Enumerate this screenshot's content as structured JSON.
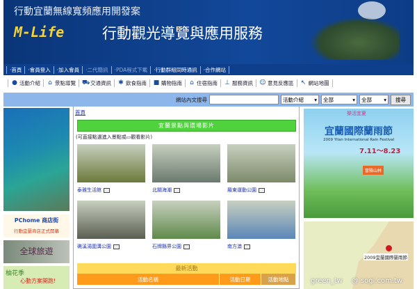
{
  "header": {
    "subtitle": "行動宜蘭無線寬頻應用開發案",
    "logo": "M-Life",
    "title": "行動觀光導覽與應用服務"
  },
  "nav": [
    {
      "label": "‧首頁"
    },
    {
      "label": "‧會員登入"
    },
    {
      "label": "‧加入會員"
    },
    {
      "label": "‧二代簡訊",
      "disabled": true
    },
    {
      "label": "‧PDA程式下載",
      "disabled": true
    },
    {
      "label": "‧行動群組同時通訊"
    },
    {
      "label": "‧合作網站"
    }
  ],
  "iconbar": [
    {
      "label": "活動介紹",
      "icon": "event-icon"
    },
    {
      "label": "景點導覽",
      "icon": "landmark-icon"
    },
    {
      "label": "交通資訊",
      "icon": "car-icon"
    },
    {
      "label": "飲食指南",
      "icon": "food-icon"
    },
    {
      "label": "購物指南",
      "icon": "shopping-icon"
    },
    {
      "label": "住宿指南",
      "icon": "hotel-icon"
    },
    {
      "label": "服務資訊",
      "icon": "service-icon"
    },
    {
      "label": "意見反應區",
      "icon": "feedback-icon"
    },
    {
      "label": "網站地圖",
      "icon": "sitemap-icon"
    }
  ],
  "search": {
    "label": "網站內文搜尋",
    "value": "",
    "category": "活動介紹",
    "area": "全部",
    "type": "全部",
    "button": "搜尋"
  },
  "left": {
    "pchome_line1": "PChome 商店街",
    "pchome_line2": "行動宜蘭商店正式開幕",
    "travel": "全球旅遊",
    "pomelo_line1": "柚花季",
    "pomelo_line2": "心動方案開跑!"
  },
  "content": {
    "breadcrumb": "首頁",
    "scenic_title": "宜蘭景點與環場影片",
    "note": "(可直接點選進入景點或▭觀看影片)",
    "spots": [
      {
        "name": "泰雅生活館",
        "color": "#6b7a3a"
      },
      {
        "name": "北關海潮",
        "color": "#6a7a6e"
      },
      {
        "name": "羅東運動公園",
        "color": "#7d8a6a"
      },
      {
        "name": "礁溪湯圍溝公園",
        "color": "#5a5e52"
      },
      {
        "name": "石牌縣界公園",
        "color": "#5f8a4a"
      },
      {
        "name": "南方澳",
        "color": "#5a86b8"
      }
    ],
    "latest_title": "最新活動",
    "table_headers": [
      "活動名稱",
      "活動日期",
      "活動地點"
    ]
  },
  "right": {
    "festival_tag": "樂活宜夏",
    "festival_title": "宜蘭國際蘭雨節",
    "festival_en": "2009 Yilan International Rain Festival",
    "festival_date": "7.11～8.23",
    "festival_sign": "冒險山林",
    "map_label": "2009宜蘭國際蘭雨節"
  },
  "watermark": "green_tw    @ sogi.com.tw"
}
